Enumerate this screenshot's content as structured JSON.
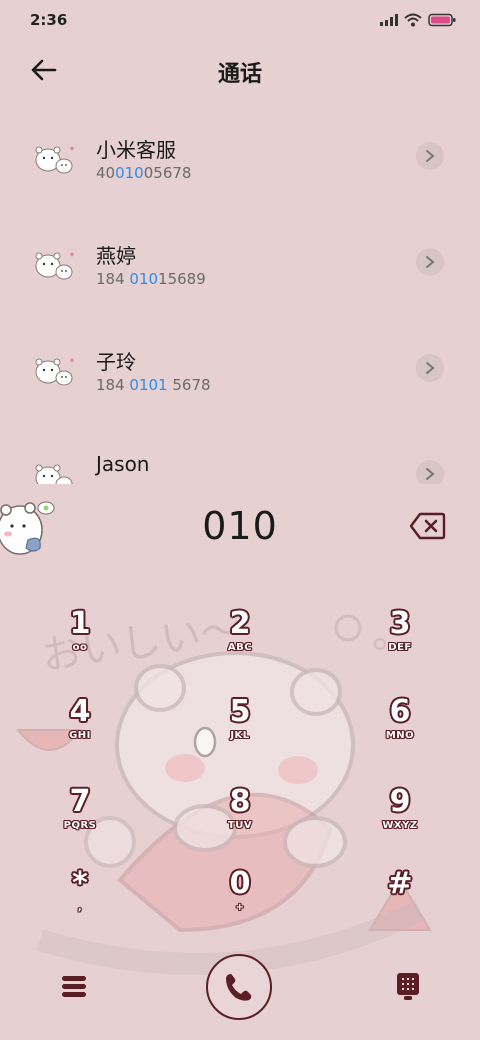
{
  "status_bar": {
    "time": "2:36"
  },
  "header": {
    "title": "通话"
  },
  "results": [
    {
      "name": "小米客服",
      "number_before": "40",
      "number_match": "010",
      "number_after": "05678"
    },
    {
      "name": "燕婷",
      "number_before": "184 ",
      "number_match": "010",
      "number_after": "15689"
    },
    {
      "name": "子玲",
      "number_before": "184 ",
      "number_match": "0101",
      "number_after": " 5678"
    },
    {
      "name": "Jason"
    }
  ],
  "dial_input": "010",
  "keypad": [
    {
      "digit": "1",
      "letters": "oo"
    },
    {
      "digit": "2",
      "letters": "ABC"
    },
    {
      "digit": "3",
      "letters": "DEF"
    },
    {
      "digit": "4",
      "letters": "GHI"
    },
    {
      "digit": "5",
      "letters": "JKL"
    },
    {
      "digit": "6",
      "letters": "MNO"
    },
    {
      "digit": "7",
      "letters": "PQRS"
    },
    {
      "digit": "8",
      "letters": "TUV"
    },
    {
      "digit": "9",
      "letters": "WXYZ"
    },
    {
      "digit": "*",
      "letters": ","
    },
    {
      "digit": "0",
      "letters": "+"
    },
    {
      "digit": "#",
      "letters": ""
    }
  ],
  "wallpaper_text": "おいしい～",
  "colors": {
    "background": "#e6d0d2",
    "accent": "#5a1f25",
    "highlight": "#2f8de4"
  },
  "icons": {
    "back": "arrow-left-icon",
    "chevron": "chevron-right-icon",
    "backspace": "backspace-icon",
    "menu": "menu-icon",
    "call": "phone-icon",
    "keypad": "dialpad-icon"
  }
}
